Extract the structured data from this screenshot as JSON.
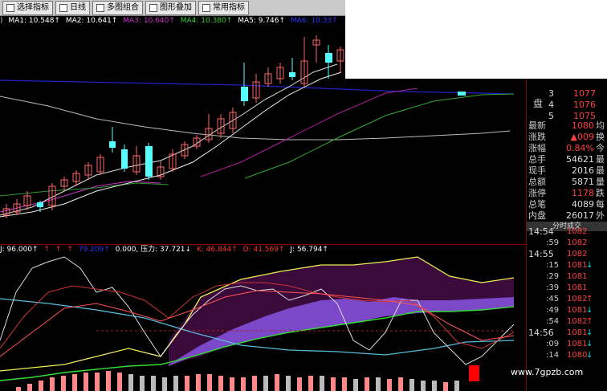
{
  "toolbar": {
    "buttons": [
      {
        "label": "选择指标"
      },
      {
        "label": "日线"
      },
      {
        "label": "多图组合"
      },
      {
        "label": "图形叠加"
      },
      {
        "label": "常用指标"
      }
    ]
  },
  "ma_legend": {
    "prefix": ")",
    "items": [
      {
        "text": "MA1: 10.548↑",
        "color": "#ffffff"
      },
      {
        "text": "MA2: 10.641↑",
        "color": "#ffffff"
      },
      {
        "text": "MA3: 10.640↑",
        "color": "#cc33cc"
      },
      {
        "text": "MA4: 10.380↑",
        "color": "#33cc33"
      },
      {
        "text": "MA5: 9.746↑",
        "color": "#ffffff"
      },
      {
        "text": "MA6: 10.33↑",
        "color": "#3333ff"
      }
    ]
  },
  "indicator_legend": {
    "items": [
      {
        "text": "J: 96.000↑",
        "color": "#ffffff"
      },
      {
        "text": "↑",
        "color": "#ff3333"
      },
      {
        "text": "↑",
        "color": "#ff3333"
      },
      {
        "text": "↑",
        "color": "#ff3333"
      },
      {
        "text": "79.209↑",
        "color": "#3333ff"
      },
      {
        "text": "0.000, 压力: 37.721↓",
        "color": "#ffffff"
      },
      {
        "text": "K: 46.844↑",
        "color": "#ff3333"
      },
      {
        "text": "D: 41.569↑",
        "color": "#ff3333"
      },
      {
        "text": "J: 56.794↑",
        "color": "#ffffff"
      }
    ]
  },
  "order_book": {
    "side_label": "盘",
    "rows": [
      {
        "level": "3",
        "price": "1077"
      },
      {
        "level": "4",
        "price": "1076"
      },
      {
        "level": "5",
        "price": "1075"
      }
    ]
  },
  "quote": {
    "rows": [
      {
        "label": "最新",
        "value": "1080",
        "extra": "均",
        "color": "#ff4040"
      },
      {
        "label": "涨跌",
        "value": "▲009",
        "extra": "换",
        "color": "#ff4040"
      },
      {
        "label": "涨幅",
        "value": "0.84%",
        "extra": "今",
        "color": "#ff4040"
      },
      {
        "label": "总手",
        "value": "54621",
        "extra": "最",
        "color": "#dddddd"
      },
      {
        "label": "现手",
        "value": "2016",
        "extra": "最",
        "color": "#dddddd"
      },
      {
        "label": "总额",
        "value": "5871",
        "extra": "量",
        "color": "#dddddd"
      },
      {
        "label": "涨停",
        "value": "1178",
        "extra": "跌",
        "color": "#ff4040"
      },
      {
        "label": "总笔",
        "value": "4089",
        "extra": "每",
        "color": "#dddddd"
      },
      {
        "label": "内盘",
        "value": "26017",
        "extra": "外",
        "color": "#dddddd"
      }
    ],
    "tab_label": "分时成交"
  },
  "ticks": [
    {
      "time": "14:54",
      "price": "1082",
      "arrow": ""
    },
    {
      "time": ":59",
      "price": "1082",
      "arrow": ""
    },
    {
      "time": "14:55",
      "price": "1082",
      "arrow": ""
    },
    {
      "time": ":15",
      "price": "1081",
      "arrow": "↓"
    },
    {
      "time": ":29",
      "price": "1081",
      "arrow": ""
    },
    {
      "time": ":39",
      "price": "1081",
      "arrow": ""
    },
    {
      "time": ":45",
      "price": "1082",
      "arrow": "↑"
    },
    {
      "time": ":49",
      "price": "1081",
      "arrow": "↓"
    },
    {
      "time": ":54",
      "price": "1082",
      "arrow": "↑"
    },
    {
      "time": "14:56",
      "price": "1081",
      "arrow": "↓"
    },
    {
      "time": ":09",
      "price": "1081",
      "arrow": "↓"
    },
    {
      "time": ":14",
      "price": "1080",
      "arrow": "↓"
    }
  ],
  "watermark": "www.7gpzb.com",
  "colors": {
    "up": "#ff4040",
    "down": "#00e0e0",
    "candle_up_outline": "#ff6666",
    "candle_down_fill": "#55ffff"
  }
}
